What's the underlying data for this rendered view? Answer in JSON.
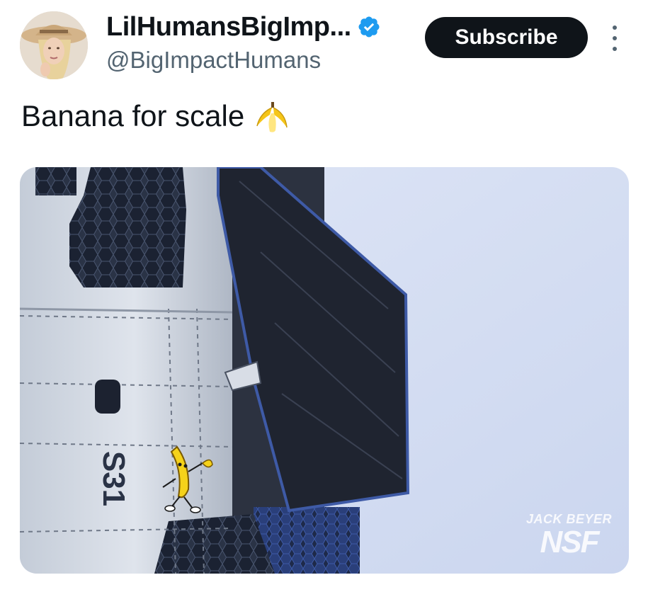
{
  "tweet": {
    "display_name": "LilHumansBigImp...",
    "handle": "@BigImpactHumans",
    "subscribe_label": "Subscribe",
    "text": "Banana for scale",
    "text_emoji": "banana-emoji"
  },
  "media": {
    "ship_label": "S31",
    "credit_name": "JACK BEYER",
    "credit_logo": "NSF"
  },
  "icons": {
    "verified": "verified-badge-icon",
    "more": "more-options-icon"
  },
  "colors": {
    "verified_blue": "#1d9bf0",
    "text_primary": "#0f1419",
    "text_secondary": "#536471",
    "subscribe_bg": "#0f1419"
  }
}
